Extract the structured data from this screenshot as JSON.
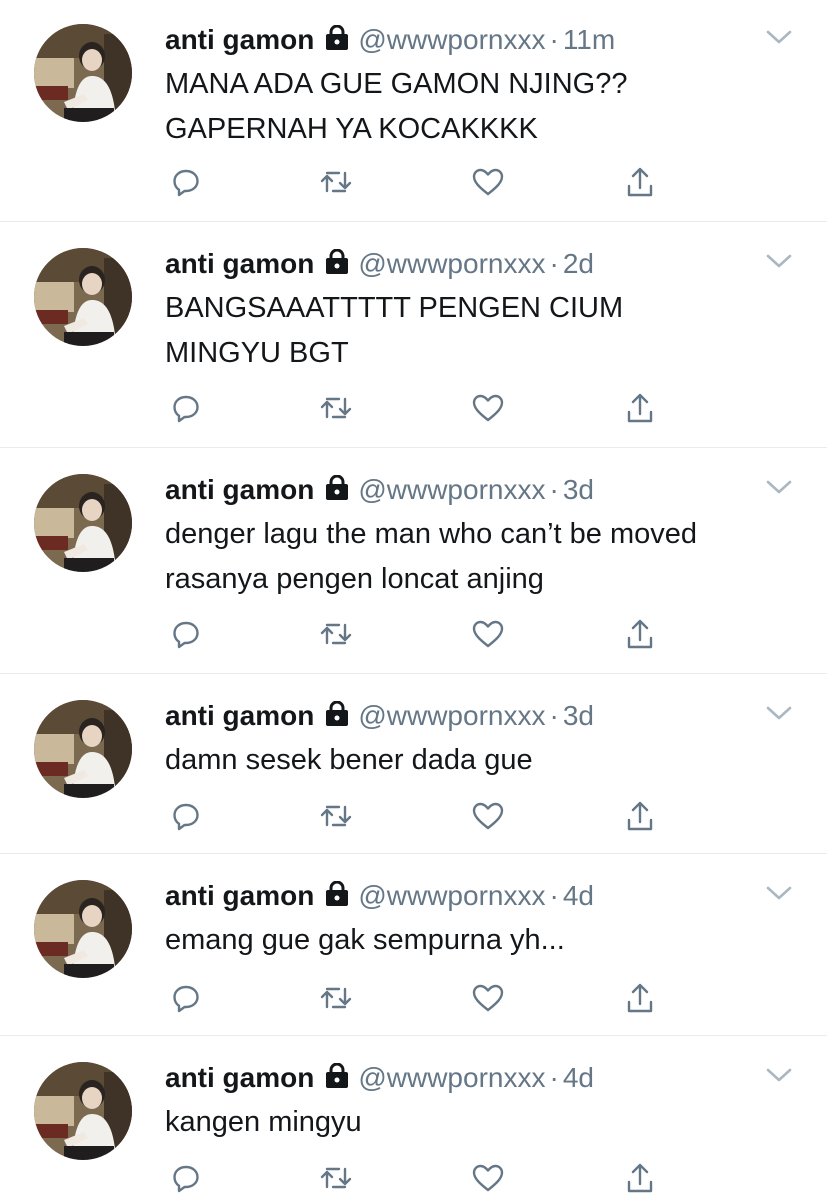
{
  "colors": {
    "name": "#14171a",
    "meta": "#657786",
    "icon": "#657786",
    "divider": "#e6ecf0"
  },
  "tweets": [
    {
      "name": "anti gamon",
      "handle": "@wwwpornxxx",
      "separator": "·",
      "time": "11m",
      "text": "MANA ADA GUE GAMON NJING??\nGAPERNAH YA KOCAKKKK",
      "icons": [
        "reply-icon",
        "retweet-icon",
        "like-icon",
        "share-icon"
      ]
    },
    {
      "name": "anti gamon",
      "handle": "@wwwpornxxx",
      "separator": "·",
      "time": "2d",
      "text": "BANGSAAATTTTT PENGEN CIUM\nMINGYU BGT",
      "icons": [
        "reply-icon",
        "retweet-icon",
        "like-icon",
        "share-icon"
      ]
    },
    {
      "name": "anti gamon",
      "handle": "@wwwpornxxx",
      "separator": "·",
      "time": "3d",
      "text": "denger lagu the man who can’t be moved\nrasanya pengen loncat anjing",
      "icons": [
        "reply-icon",
        "retweet-icon",
        "like-icon",
        "share-icon"
      ]
    },
    {
      "name": "anti gamon",
      "handle": "@wwwpornxxx",
      "separator": "·",
      "time": "3d",
      "text": "damn sesek bener dada gue",
      "icons": [
        "reply-icon",
        "retweet-icon",
        "like-icon",
        "share-icon"
      ]
    },
    {
      "name": "anti gamon",
      "handle": "@wwwpornxxx",
      "separator": "·",
      "time": "4d",
      "text": "emang gue gak sempurna yh...",
      "icons": [
        "reply-icon",
        "retweet-icon",
        "like-icon",
        "share-icon"
      ]
    },
    {
      "name": "anti gamon",
      "handle": "@wwwpornxxx",
      "separator": "·",
      "time": "4d",
      "text": "kangen mingyu",
      "icons": [
        "reply-icon",
        "retweet-icon",
        "like-icon",
        "share-icon"
      ]
    }
  ]
}
